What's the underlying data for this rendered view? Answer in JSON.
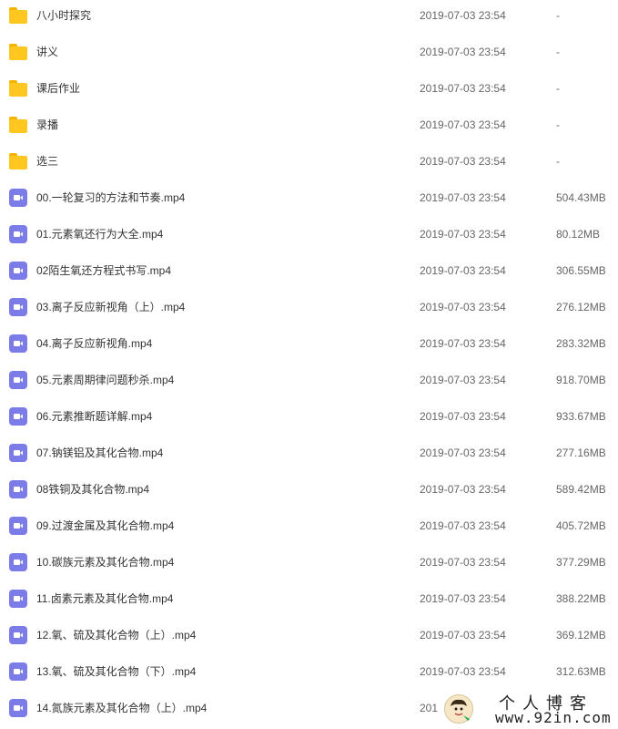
{
  "files": [
    {
      "name": "八小时探究",
      "date": "2019-07-03 23:54",
      "size": "-",
      "icon": "folder-icon"
    },
    {
      "name": "讲义",
      "date": "2019-07-03 23:54",
      "size": "-",
      "icon": "folder-icon"
    },
    {
      "name": "课后作业",
      "date": "2019-07-03 23:54",
      "size": "-",
      "icon": "folder-icon"
    },
    {
      "name": "录播",
      "date": "2019-07-03 23:54",
      "size": "-",
      "icon": "folder-icon"
    },
    {
      "name": "选三",
      "date": "2019-07-03 23:54",
      "size": "-",
      "icon": "folder-icon"
    },
    {
      "name": "00.一轮复习的方法和节奏.mp4",
      "date": "2019-07-03 23:54",
      "size": "504.43MB",
      "icon": "video-icon"
    },
    {
      "name": "01.元素氧还行为大全.mp4",
      "date": "2019-07-03 23:54",
      "size": "80.12MB",
      "icon": "video-icon"
    },
    {
      "name": "02陌生氧还方程式书写.mp4",
      "date": "2019-07-03 23:54",
      "size": "306.55MB",
      "icon": "video-icon"
    },
    {
      "name": "03.离子反应新视角（上）.mp4",
      "date": "2019-07-03 23:54",
      "size": "276.12MB",
      "icon": "video-icon"
    },
    {
      "name": "04.离子反应新视角.mp4",
      "date": "2019-07-03 23:54",
      "size": "283.32MB",
      "icon": "video-icon"
    },
    {
      "name": "05.元素周期律问题秒杀.mp4",
      "date": "2019-07-03 23:54",
      "size": "918.70MB",
      "icon": "video-icon"
    },
    {
      "name": "06.元素推断题详解.mp4",
      "date": "2019-07-03 23:54",
      "size": "933.67MB",
      "icon": "video-icon"
    },
    {
      "name": "07.钠镁铝及其化合物.mp4",
      "date": "2019-07-03 23:54",
      "size": "277.16MB",
      "icon": "video-icon"
    },
    {
      "name": "08铁铜及其化合物.mp4",
      "date": "2019-07-03 23:54",
      "size": "589.42MB",
      "icon": "video-icon"
    },
    {
      "name": "09.过渡金属及其化合物.mp4",
      "date": "2019-07-03 23:54",
      "size": "405.72MB",
      "icon": "video-icon"
    },
    {
      "name": "10.碳族元素及其化合物.mp4",
      "date": "2019-07-03 23:54",
      "size": "377.29MB",
      "icon": "video-icon"
    },
    {
      "name": "11.卤素元素及其化合物.mp4",
      "date": "2019-07-03 23:54",
      "size": "388.22MB",
      "icon": "video-icon"
    },
    {
      "name": "12.氧、硫及其化合物（上）.mp4",
      "date": "2019-07-03 23:54",
      "size": "369.12MB",
      "icon": "video-icon"
    },
    {
      "name": "13.氧、硫及其化合物（下）.mp4",
      "date": "2019-07-03 23:54",
      "size": "312.63MB",
      "icon": "video-icon"
    },
    {
      "name": "14.氮族元素及其化合物（上）.mp4",
      "date": "201",
      "size": "",
      "icon": "video-icon"
    }
  ],
  "watermark": {
    "title": "个人博客",
    "url": "www.92in.com"
  },
  "colors": {
    "folder": "#ffc720",
    "video": "#7b7ce8"
  }
}
